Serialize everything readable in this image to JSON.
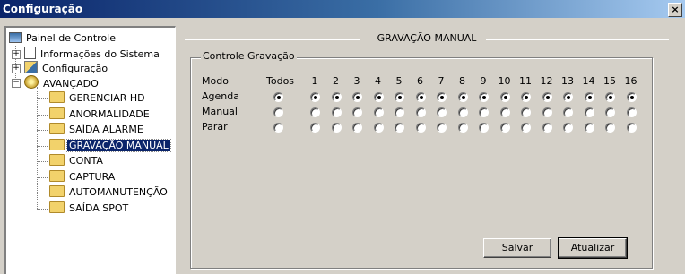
{
  "window": {
    "title": "Configuração",
    "close_label": "×"
  },
  "tree": {
    "root": "Painel de Controle",
    "items": [
      {
        "label": "Informações do Sistema",
        "expander": "+"
      },
      {
        "label": "Configuração",
        "expander": "+"
      },
      {
        "label": "AVANÇADO",
        "expander": "−"
      }
    ],
    "advanced_children": [
      {
        "label": "GERENCIAR HD"
      },
      {
        "label": "ANORMALIDADE"
      },
      {
        "label": "SAÍDA ALARME"
      },
      {
        "label": "GRAVAÇÃO MANUAL",
        "selected": true
      },
      {
        "label": "CONTA"
      },
      {
        "label": "CAPTURA"
      },
      {
        "label": "AUTOMANUTENÇÃO"
      },
      {
        "label": "SAÍDA SPOT"
      }
    ]
  },
  "panel": {
    "section_title": "GRAVAÇÃO MANUAL",
    "group_title": "Controle Gravação",
    "mode_header": "Modo",
    "all_header": "Todos",
    "channels": [
      "1",
      "2",
      "3",
      "4",
      "5",
      "6",
      "7",
      "8",
      "9",
      "10",
      "11",
      "12",
      "13",
      "14",
      "15",
      "16"
    ],
    "modes": [
      {
        "label": "Agenda",
        "selected": true
      },
      {
        "label": "Manual",
        "selected": false
      },
      {
        "label": "Parar",
        "selected": false
      }
    ]
  },
  "buttons": {
    "save": "Salvar",
    "refresh": "Atualizar"
  }
}
